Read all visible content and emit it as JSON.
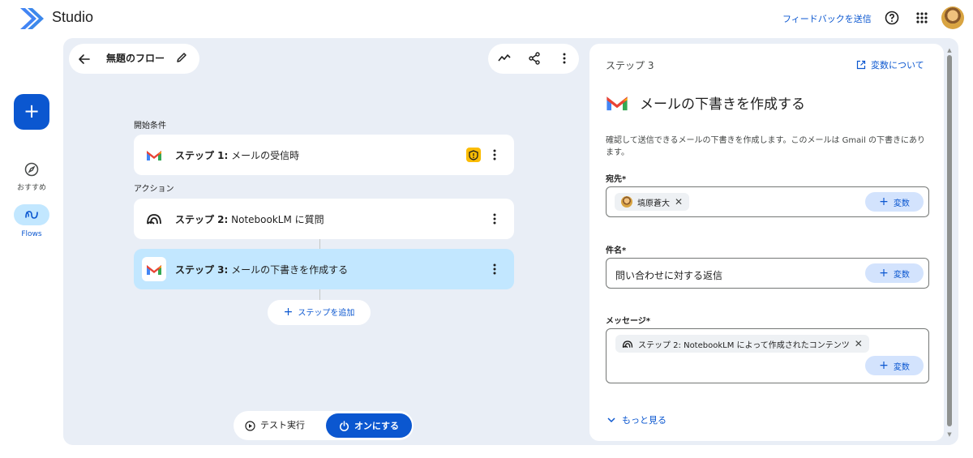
{
  "app": {
    "title": "Studio"
  },
  "header": {
    "feedback_label": "フィードバックを送信"
  },
  "nav": {
    "recommended_label": "おすすめ",
    "flows_label": "Flows"
  },
  "flow": {
    "name": "無題のフロー",
    "start_label": "開始条件",
    "action_label": "アクション",
    "steps": [
      {
        "prefix": "ステップ 1:",
        "text": " メールの受信時",
        "icon": "gmail-icon",
        "warning": true
      },
      {
        "prefix": "ステップ 2:",
        "text": " NotebookLM に質問",
        "icon": "notebooklm-icon"
      },
      {
        "prefix": "ステップ 3:",
        "text": " メールの下書きを作成する",
        "icon": "gmail-icon",
        "selected": true
      }
    ],
    "add_step_label": "ステップを追加",
    "test_run_label": "テスト実行",
    "turn_on_label": "オンにする"
  },
  "panel": {
    "step_label": "ステップ 3",
    "vars_link_label": "変数について",
    "title": "メールの下書きを作成する",
    "description": "確認して送信できるメールの下書きを作成します。このメールは Gmail の下書きにあります。",
    "to": {
      "label": "宛先*",
      "chip": "塙原蒼大"
    },
    "subject": {
      "label": "件名*",
      "value": "問い合わせに対する返信"
    },
    "message": {
      "label": "メッセージ*",
      "chip": "ステップ 2: NotebookLM によって作成されたコンテンツ"
    },
    "var_button_label": "変数",
    "more_label": "もっと見る"
  },
  "colors": {
    "accent": "#0b57d0",
    "selected": "#c2e7ff",
    "canvas": "#e9eef6",
    "warning": "#fbbc04"
  }
}
